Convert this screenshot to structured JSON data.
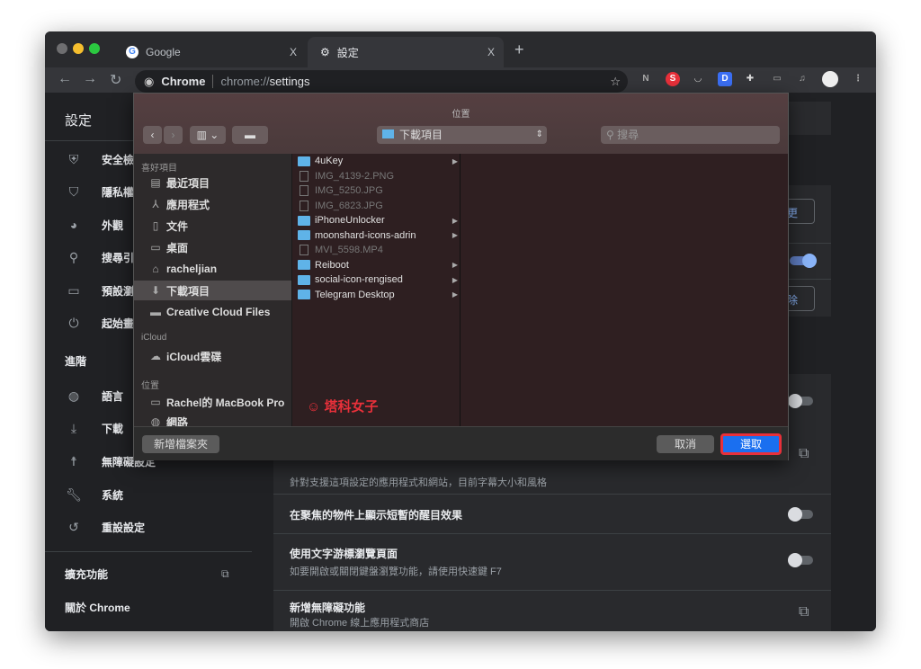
{
  "browser": {
    "tabs": [
      {
        "title": "Google",
        "icon": "google-icon"
      },
      {
        "title": "設定",
        "icon": "gear-icon"
      }
    ],
    "new_tab": "+",
    "close": "X",
    "omnibox": {
      "chip": "Chrome",
      "url_prefix": "chrome://",
      "url_path": "settings"
    },
    "extensions": [
      "N",
      "S",
      "pocket",
      "D",
      "puzzle",
      "cast",
      "media",
      "avatar",
      "menu"
    ]
  },
  "settings": {
    "title": "設定",
    "sidebar": [
      {
        "label": "安全檢",
        "icon": "shield-check-icon"
      },
      {
        "label": "隱私權",
        "icon": "shield-icon"
      },
      {
        "label": "外觀",
        "icon": "palette-icon"
      },
      {
        "label": "搜尋引",
        "icon": "search-icon"
      },
      {
        "label": "預設瀏",
        "icon": "browser-icon"
      },
      {
        "label": "起始畫",
        "icon": "power-icon"
      }
    ],
    "advanced": "進階",
    "advanced_items": [
      {
        "label": "語言",
        "icon": "globe-icon"
      },
      {
        "label": "下載",
        "icon": "download-icon"
      },
      {
        "label": "無障礙設定",
        "icon": "accessibility-icon"
      },
      {
        "label": "系統",
        "icon": "wrench-icon"
      },
      {
        "label": "重設設定",
        "icon": "restore-icon"
      }
    ],
    "extensions": "擴充功能",
    "about": "關於 Chrome",
    "main": {
      "btn1": "更",
      "btn2": "除",
      "partial_sub": "針對支援這項設定的應用程式和網站，目前字幕大小和風格",
      "rows": [
        {
          "title": "在聚焦的物件上顯示短暫的醒目效果",
          "on": false
        },
        {
          "title": "使用文字游標瀏覽頁面",
          "sub": "如要開啟或關閉鍵盤瀏覽功能，請使用快速鍵 F7",
          "on": false
        },
        {
          "title": "新增無障礙功能",
          "sub": "開啟 Chrome 線上應用程式商店"
        }
      ]
    }
  },
  "dialog": {
    "title": "位置",
    "location": "下載項目",
    "search_placeholder": "搜尋",
    "sidebar": {
      "favorites_header": "喜好項目",
      "favorites": [
        {
          "label": "最近項目",
          "icon": "recents-icon"
        },
        {
          "label": "應用程式",
          "icon": "applications-icon"
        },
        {
          "label": "文件",
          "icon": "documents-icon"
        },
        {
          "label": "桌面",
          "icon": "desktop-icon"
        },
        {
          "label": "racheljian",
          "icon": "home-icon"
        },
        {
          "label": "下載項目",
          "icon": "downloads-icon",
          "selected": true
        },
        {
          "label": "Creative Cloud Files",
          "icon": "folder-icon"
        }
      ],
      "icloud_header": "iCloud",
      "icloud": [
        {
          "label": "iCloud雲碟",
          "icon": "cloud-icon"
        }
      ],
      "locations_header": "位置",
      "locations": [
        {
          "label": "Rachel的 MacBook Pro",
          "icon": "laptop-icon"
        },
        {
          "label": "網路",
          "icon": "network-icon"
        }
      ]
    },
    "files": [
      {
        "name": "4uKey",
        "folder": true
      },
      {
        "name": "IMG_4139-2.PNG",
        "folder": false
      },
      {
        "name": "IMG_5250.JPG",
        "folder": false
      },
      {
        "name": "IMG_6823.JPG",
        "folder": false
      },
      {
        "name": "iPhoneUnlocker",
        "folder": true
      },
      {
        "name": "moonshard-icons-adrin",
        "folder": true
      },
      {
        "name": "MVI_5598.MP4",
        "folder": false
      },
      {
        "name": "Reiboot",
        "folder": true
      },
      {
        "name": "social-icon-rengised",
        "folder": true
      },
      {
        "name": "Telegram Desktop",
        "folder": true
      }
    ],
    "watermark": "塔科女子",
    "new_folder": "新增檔案夾",
    "cancel": "取消",
    "choose": "選取"
  },
  "colors": {
    "accent": "#1a6ff0",
    "highlight": "#e8303a"
  }
}
